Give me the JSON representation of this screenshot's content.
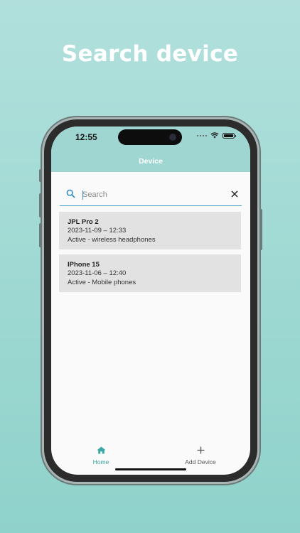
{
  "promo": {
    "title": "Search device"
  },
  "status_bar": {
    "time": "12:55"
  },
  "appbar": {
    "title": "Device"
  },
  "search": {
    "placeholder": "Search",
    "value": ""
  },
  "devices": [
    {
      "name": "JPL Pro 2",
      "datetime": "2023-11-09 – 12:33",
      "status": "Active - wireless headphones"
    },
    {
      "name": "IPhone 15",
      "datetime": "2023-11-06 – 12:40",
      "status": "Active - Mobile phones"
    }
  ],
  "nav": {
    "home_label": "Home",
    "add_label": "Add Device",
    "active_color": "#3aa8a0"
  },
  "icons": {
    "search": "search-icon",
    "clear": "close-icon",
    "home": "home-icon",
    "add": "plus-icon",
    "wifi": "wifi-icon",
    "battery": "battery-icon"
  },
  "colors": {
    "background": "#9fd6d1",
    "appbar": "#9fd6d1",
    "search_underline": "#4aa3c8",
    "card": "#e2e2e2"
  }
}
